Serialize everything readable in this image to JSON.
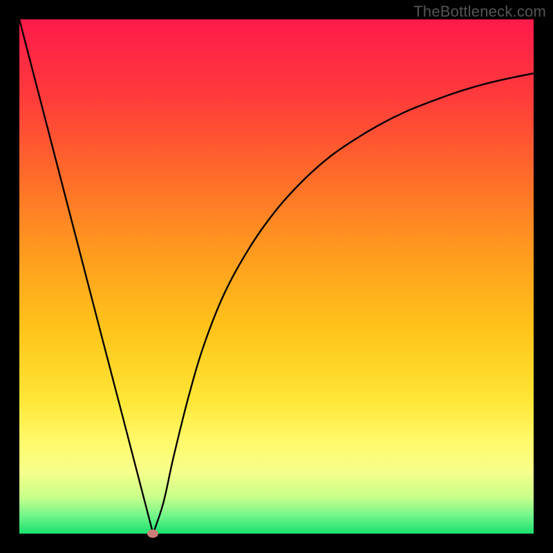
{
  "watermark": "TheBottleneck.com",
  "chart_data": {
    "type": "line",
    "title": "",
    "xlabel": "",
    "ylabel": "",
    "xlim": [
      0,
      100
    ],
    "ylim": [
      0,
      100
    ],
    "grid": false,
    "legend": false,
    "series": [
      {
        "name": "bottleneck-curve-left",
        "x": [
          0,
          4,
          8,
          12,
          16,
          20,
          24,
          26
        ],
        "values": [
          100,
          84.6,
          69.2,
          53.8,
          38.4,
          23.1,
          7.7,
          0
        ]
      },
      {
        "name": "bottleneck-curve-right",
        "x": [
          26,
          28,
          30,
          33,
          36,
          40,
          45,
          50,
          55,
          60,
          65,
          70,
          75,
          80,
          85,
          90,
          95,
          100
        ],
        "values": [
          0,
          6,
          15,
          27,
          37,
          47,
          56,
          63,
          68.5,
          73,
          76.5,
          79.5,
          82,
          84,
          85.8,
          87.3,
          88.5,
          89.5
        ]
      }
    ],
    "optimum_marker": {
      "x": 26,
      "y": 0,
      "color": "#cc7d78"
    },
    "gradient_stops": [
      {
        "offset": 0.0,
        "color": "#ff1a4b"
      },
      {
        "offset": 0.15,
        "color": "#ff3b3b"
      },
      {
        "offset": 0.3,
        "color": "#ff6a2a"
      },
      {
        "offset": 0.45,
        "color": "#ff9a1f"
      },
      {
        "offset": 0.6,
        "color": "#ffc31a"
      },
      {
        "offset": 0.74,
        "color": "#ffe636"
      },
      {
        "offset": 0.82,
        "color": "#fff96b"
      },
      {
        "offset": 0.88,
        "color": "#f6ff8a"
      },
      {
        "offset": 0.93,
        "color": "#c7ff8a"
      },
      {
        "offset": 0.965,
        "color": "#72f58a"
      },
      {
        "offset": 1.0,
        "color": "#19e06e"
      }
    ]
  }
}
